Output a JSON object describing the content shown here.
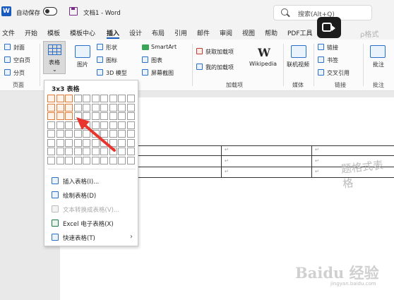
{
  "app": {
    "logo_letter": "W",
    "autosave_label": "自动保存",
    "autosave_state": "off",
    "doc_title": "文档1  -  Word",
    "search_placeholder": "搜索(Alt+Q)"
  },
  "menu": {
    "tabs": [
      "文件",
      "开始",
      "模板",
      "模板中心",
      "插入",
      "设计",
      "布局",
      "引用",
      "邮件",
      "审阅",
      "视图",
      "帮助",
      "PDF工具"
    ],
    "active": "插入"
  },
  "ribbon": {
    "cover": "封面",
    "blank_page": "空白页",
    "page_break": "分页",
    "group_pages": "页面",
    "table_label": "表格",
    "picture_label": "图片",
    "shapes": "形状",
    "icons": "图标",
    "3d_models": "3D 模型",
    "smartart": "SmartArt",
    "chart": "图表",
    "screenshot": "屏幕截图",
    "get_addins": "获取加载项",
    "my_addins": "我的加载项",
    "wikipedia_logo": "W",
    "wikipedia": "Wikipedia",
    "group_addins": "加载项",
    "online_video": "联机视频",
    "group_media": "媒体",
    "link": "链接",
    "bookmark": "书签",
    "cross_ref": "交叉引用",
    "group_links": "链接",
    "comment": "批注",
    "group_comments": "批注"
  },
  "dropdown": {
    "title": "3x3 表格",
    "grid_cols": 10,
    "grid_rows": 8,
    "selected_cols": 3,
    "selected_rows": 3,
    "items": [
      {
        "label": "插入表格(I)...",
        "icon": "insert-table-icon",
        "disabled": false
      },
      {
        "label": "绘制表格(D)",
        "icon": "draw-table-icon",
        "disabled": false
      },
      {
        "label": "文本转换成表格(V)...",
        "icon": "convert-text-icon",
        "disabled": true
      },
      {
        "label": "Excel 电子表格(X)",
        "icon": "excel-icon",
        "disabled": false
      },
      {
        "label": "快速表格(T)",
        "icon": "quick-tables-icon",
        "disabled": false,
        "submenu": true
      }
    ]
  },
  "document": {
    "cell_mark": "↵"
  },
  "watermark": {
    "brand": "Baidu 经验",
    "url": "jingyan.baidu.com",
    "side": "题格式表格",
    "corner": "ρ格式"
  }
}
